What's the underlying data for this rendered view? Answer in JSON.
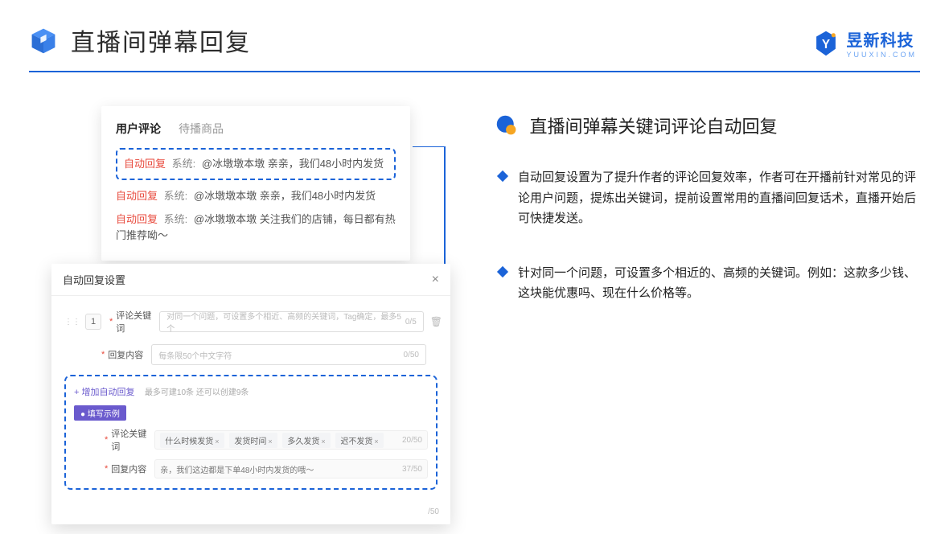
{
  "header": {
    "title": "直播间弹幕回复"
  },
  "brand": {
    "name": "昱新科技",
    "sub": "YUUXIN.COM"
  },
  "comment_card": {
    "tabs": {
      "active": "用户评论",
      "inactive": "待播商品"
    },
    "highlight": {
      "badge": "自动回复",
      "sys": "系统:",
      "text": "@冰墩墩本墩 亲亲，我们48小时内发货"
    },
    "lines": [
      {
        "badge": "自动回复",
        "sys": "系统:",
        "text": "@冰墩墩本墩 亲亲，我们48小时内发货"
      },
      {
        "badge": "自动回复",
        "sys": "系统:",
        "text": "@冰墩墩本墩 关注我们的店铺，每日都有热门推荐呦～"
      }
    ]
  },
  "settings": {
    "title": "自动回复设置",
    "row1": {
      "index": "1",
      "label": "评论关键词",
      "placeholder": "对同一个问题，可设置多个相近、高频的关键词，Tag确定，最多5个",
      "counter": "0/5"
    },
    "row2": {
      "label": "回复内容",
      "placeholder": "每条限50个中文字符",
      "counter": "0/50"
    },
    "add_link": "+ 增加自动回复",
    "add_hint": "最多可建10条 还可以创建9条",
    "example_badge": "● 填写示例",
    "ex_row1": {
      "label": "评论关键词",
      "tags": [
        "什么时候发货",
        "发货时间",
        "多久发货",
        "迟不发货"
      ],
      "counter": "20/50"
    },
    "ex_row2": {
      "label": "回复内容",
      "value": "亲，我们这边都是下单48小时内发货的哦～",
      "counter": "37/50"
    },
    "bottom_counter": "/50"
  },
  "right": {
    "section_title": "直播间弹幕关键词评论自动回复",
    "bullet1": "自动回复设置为了提升作者的评论回复效率，作者可在开播前针对常见的评论用户问题，提炼出关键词，提前设置常用的直播间回复话术，直播开始后可快捷发送。",
    "bullet2": "针对同一个问题，可设置多个相近的、高频的关键词。例如：这款多少钱、这块能优惠吗、现在什么价格等。"
  }
}
